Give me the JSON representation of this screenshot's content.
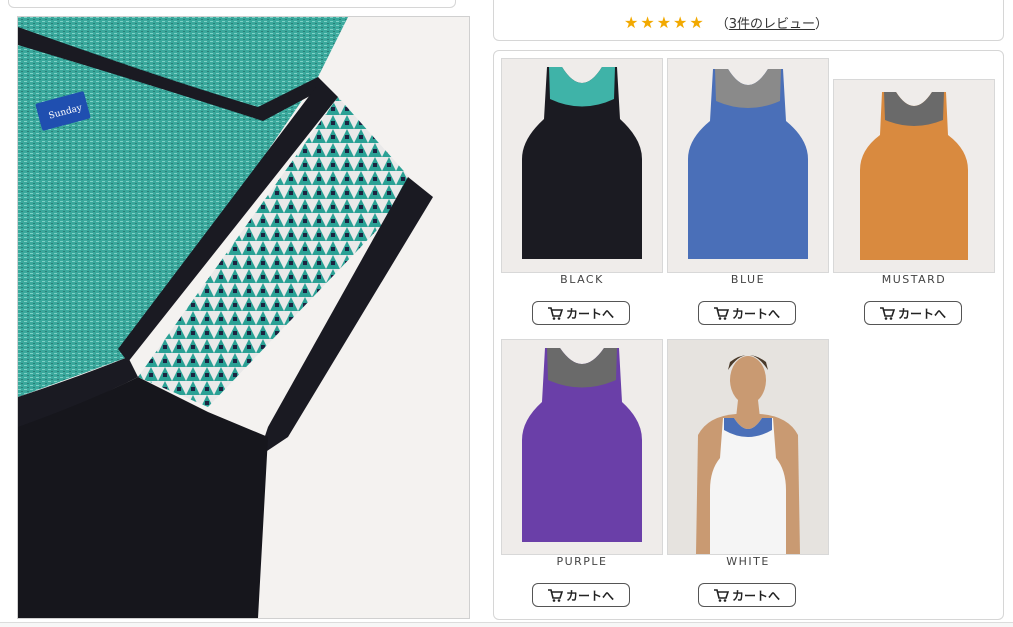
{
  "review": {
    "stars": "★★★★★",
    "rating": 5,
    "count_text": "3件のレビュー",
    "open_paren": "（",
    "close_paren": "）"
  },
  "variants": [
    {
      "label": "BLACK",
      "button": "カートへ",
      "body_color": "#1b1b22",
      "trim_color": "#3fb3a8"
    },
    {
      "label": "BLUE",
      "button": "カートへ",
      "body_color": "#4a6fb8",
      "trim_color": "#8a8a8a"
    },
    {
      "label": "MUSTARD",
      "button": "カートへ",
      "body_color": "#d98a3f",
      "trim_color": "#6a6a6a"
    },
    {
      "label": "PURPLE",
      "button": "カートへ",
      "body_color": "#6a3fa8",
      "trim_color": "#6a6a6a"
    },
    {
      "label": "WHITE",
      "button": "カートへ",
      "body_color": "#f5f5f5",
      "trim_color": "#4a6fb8"
    }
  ],
  "icons": {
    "cart": "cart-icon",
    "star": "star-icon"
  }
}
